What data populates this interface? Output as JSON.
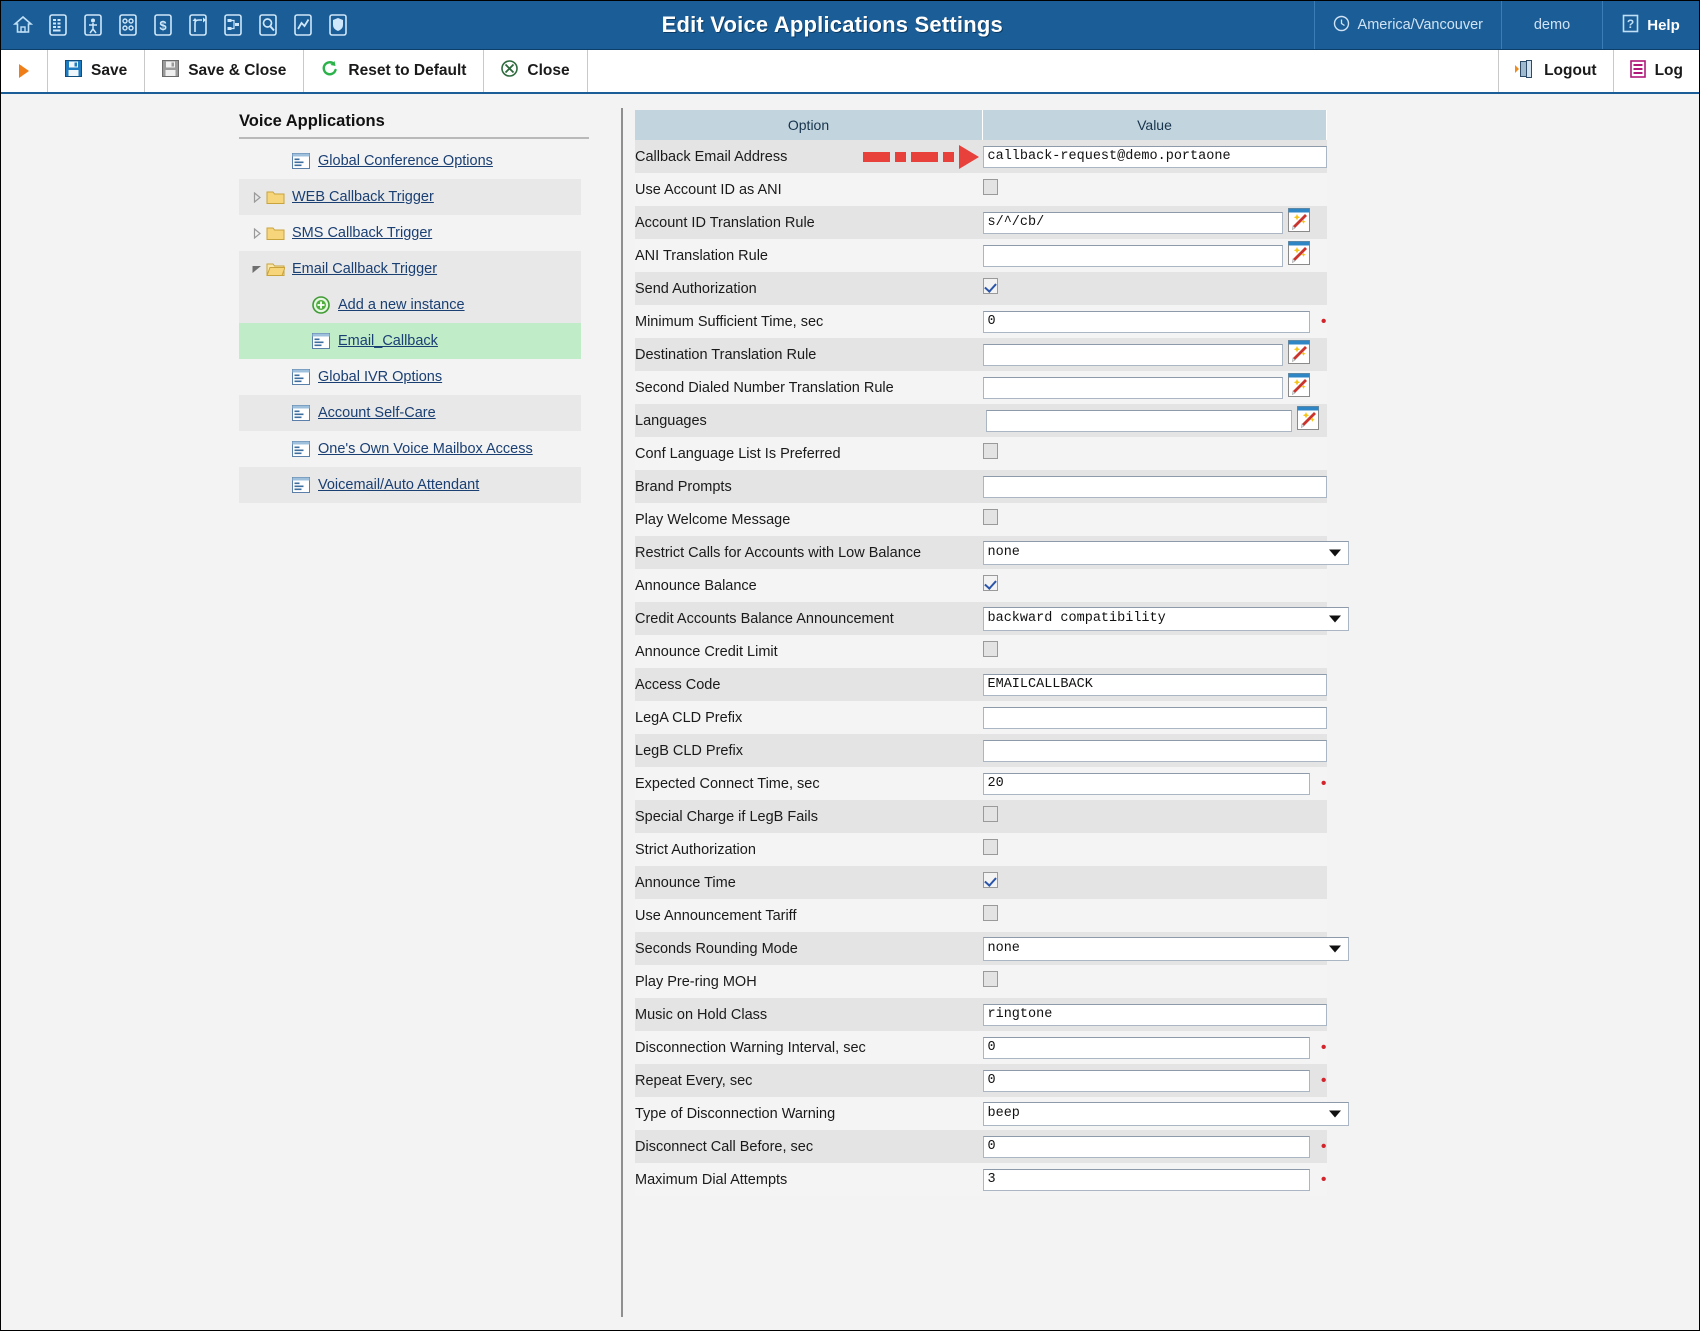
{
  "header": {
    "title": "Edit Voice Applications Settings",
    "timezone": "America/Vancouver",
    "user": "demo",
    "help": "Help",
    "clock_icon": "clock-icon",
    "help_icon": "question-mark-icon",
    "nav_icons": [
      {
        "name": "home-icon"
      },
      {
        "name": "billing-table-icon"
      },
      {
        "name": "person-icon"
      },
      {
        "name": "options-grid-icon"
      },
      {
        "name": "dollar-icon"
      },
      {
        "name": "routing-icon"
      },
      {
        "name": "network-icon"
      },
      {
        "name": "search-icon"
      },
      {
        "name": "chart-icon"
      },
      {
        "name": "shield-icon"
      }
    ]
  },
  "toolbar": {
    "play_icon": "orange-play-icon",
    "save": "Save",
    "save_close": "Save & Close",
    "reset": "Reset to Default",
    "close": "Close",
    "logout": "Logout",
    "log": "Log"
  },
  "sidebar": {
    "title": "Voice Applications",
    "items": [
      {
        "label": "Global Conference Options",
        "icon": "list-item-icon",
        "indent": 1,
        "stripe": "even",
        "twist": "none"
      },
      {
        "label": "WEB Callback Trigger",
        "icon": "folder-icon",
        "indent": 0,
        "stripe": "odd",
        "twist": "collapsed"
      },
      {
        "label": "SMS Callback Trigger",
        "icon": "folder-icon",
        "indent": 0,
        "stripe": "even",
        "twist": "collapsed"
      },
      {
        "label": "Email Callback Trigger",
        "icon": "folder-open-icon",
        "indent": 0,
        "stripe": "odd",
        "twist": "expanded"
      },
      {
        "label": "Add a new instance",
        "icon": "add-circle-icon",
        "indent": 2,
        "stripe": "odd",
        "twist": "none"
      },
      {
        "label": "Email_Callback",
        "icon": "list-item-icon",
        "indent": 2,
        "stripe": "sel",
        "twist": "none"
      },
      {
        "label": "Global IVR Options",
        "icon": "list-item-icon",
        "indent": 1,
        "stripe": "even",
        "twist": "none"
      },
      {
        "label": "Account Self-Care",
        "icon": "list-item-icon",
        "indent": 1,
        "stripe": "odd",
        "twist": "none"
      },
      {
        "label": "One's Own Voice Mailbox Access",
        "icon": "list-item-icon",
        "indent": 1,
        "stripe": "even",
        "twist": "none"
      },
      {
        "label": "Voicemail/Auto Attendant",
        "icon": "list-item-icon",
        "indent": 1,
        "stripe": "odd",
        "twist": "none"
      }
    ]
  },
  "settings": {
    "col_option": "Option",
    "col_value": "Value",
    "annotation": {
      "type": "red-dashed-arrow",
      "color": "#e8403a",
      "points_at": "Callback Email Address"
    },
    "rows": [
      {
        "label": "Callback Email Address",
        "type": "text",
        "value": "callback-request@demo.portaone",
        "annotated": true
      },
      {
        "label": "Use Account ID as ANI",
        "type": "checkbox",
        "checked": false
      },
      {
        "label": "Account ID Translation Rule",
        "type": "text-wand",
        "value": "s/^/cb/"
      },
      {
        "label": "ANI Translation Rule",
        "type": "text-wand",
        "value": ""
      },
      {
        "label": "Send Authorization",
        "type": "checkbox",
        "checked": true
      },
      {
        "label": "Minimum Sufficient Time, sec",
        "type": "text",
        "value": "0",
        "required": true
      },
      {
        "label": "Destination Translation Rule",
        "type": "text-wand",
        "value": ""
      },
      {
        "label": "Second Dialed Number Translation Rule",
        "type": "text-wand",
        "value": ""
      },
      {
        "label": "Languages",
        "type": "text-wand-narrow",
        "value": ""
      },
      {
        "label": "Conf Language List Is Preferred",
        "type": "checkbox",
        "checked": false
      },
      {
        "label": "Brand Prompts",
        "type": "text",
        "value": ""
      },
      {
        "label": "Play Welcome Message",
        "type": "checkbox",
        "checked": false
      },
      {
        "label": "Restrict Calls for Accounts with Low Balance",
        "type": "select",
        "value": "none"
      },
      {
        "label": "Announce Balance",
        "type": "checkbox",
        "checked": true
      },
      {
        "label": "Credit Accounts Balance Announcement",
        "type": "select",
        "value": "backward compatibility"
      },
      {
        "label": "Announce Credit Limit",
        "type": "checkbox",
        "checked": false
      },
      {
        "label": "Access Code",
        "type": "text",
        "value": "EMAILCALLBACK"
      },
      {
        "label": "LegA CLD Prefix",
        "type": "text",
        "value": ""
      },
      {
        "label": "LegB CLD Prefix",
        "type": "text",
        "value": ""
      },
      {
        "label": "Expected Connect Time, sec",
        "type": "text",
        "value": "20",
        "required": true
      },
      {
        "label": "Special Charge if LegB Fails",
        "type": "checkbox",
        "checked": false
      },
      {
        "label": "Strict Authorization",
        "type": "checkbox",
        "checked": false
      },
      {
        "label": "Announce Time",
        "type": "checkbox",
        "checked": true
      },
      {
        "label": "Use Announcement Tariff",
        "type": "checkbox",
        "checked": false
      },
      {
        "label": "Seconds Rounding Mode",
        "type": "select",
        "value": "none"
      },
      {
        "label": "Play Pre-ring MOH",
        "type": "checkbox",
        "checked": false
      },
      {
        "label": "Music on Hold Class",
        "type": "text",
        "value": "ringtone"
      },
      {
        "label": "Disconnection Warning Interval, sec",
        "type": "text",
        "value": "0",
        "required": true
      },
      {
        "label": "Repeat Every, sec",
        "type": "text",
        "value": "0",
        "required": true
      },
      {
        "label": "Type of Disconnection Warning",
        "type": "select",
        "value": "beep"
      },
      {
        "label": "Disconnect Call Before, sec",
        "type": "text",
        "value": "0",
        "required": true
      },
      {
        "label": "Maximum Dial Attempts",
        "type": "text",
        "value": "3",
        "required": true
      }
    ]
  },
  "colors": {
    "header_blue": "#1b5d96",
    "selected_green": "#c0ecc8",
    "annotation_red": "#e8403a",
    "required_red": "#d4242b",
    "table_head": "#c2d4de"
  }
}
